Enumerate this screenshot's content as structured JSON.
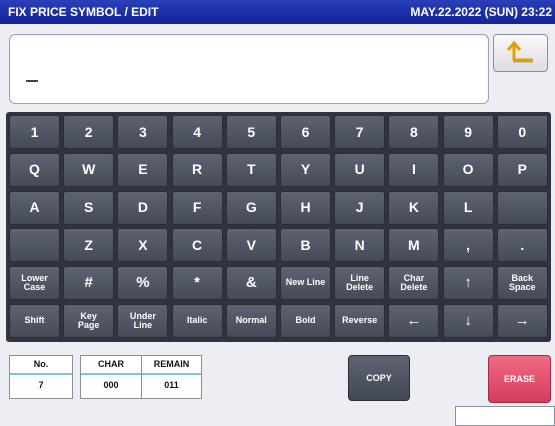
{
  "header": {
    "title": "FIX PRICE SYMBOL / EDIT",
    "datetime": "MAY.22.2022 (SUN)  23:22"
  },
  "editor": {
    "text": ""
  },
  "return_button": {
    "icon": "return-arrow-icon"
  },
  "keyboard": {
    "row1": [
      "1",
      "2",
      "3",
      "4",
      "5",
      "6",
      "7",
      "8",
      "9",
      "0"
    ],
    "row2": [
      "Q",
      "W",
      "E",
      "R",
      "T",
      "Y",
      "U",
      "I",
      "O",
      "P"
    ],
    "row3": [
      "A",
      "S",
      "D",
      "F",
      "G",
      "H",
      "J",
      "K",
      "L",
      ""
    ],
    "row4": [
      "",
      "Z",
      "X",
      "C",
      "V",
      "B",
      "N",
      "M",
      ",",
      "."
    ],
    "row5": [
      "Lower\nCase",
      "#",
      "%",
      "*",
      "&",
      "New Line",
      "Line\nDelete",
      "Char\nDelete",
      "↑",
      "Back\nSpace"
    ],
    "row6": [
      "Shift",
      "Key\nPage",
      "Under\nLine",
      "Italic",
      "Normal",
      "Bold",
      "Reverse",
      "←",
      "↓",
      "→"
    ]
  },
  "info": {
    "no_label": "No.",
    "no_value": "7",
    "char_label": "CHAR",
    "char_value": "000",
    "remain_label": "REMAIN",
    "remain_value": "011"
  },
  "copy_button": "COPY",
  "erase_button": "ERASE"
}
